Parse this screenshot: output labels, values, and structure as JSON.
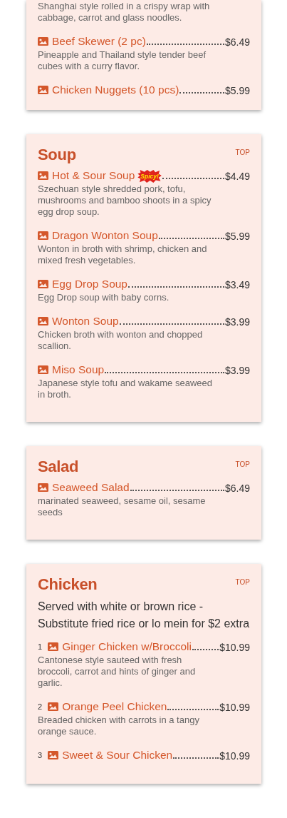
{
  "sections": [
    {
      "items": [
        {
          "description": "Shanghai style rolled in a crispy wrap with cabbage, carrot and glass noodles."
        },
        {
          "name": "Beef Skewer (2 pc)",
          "price": "$6.49",
          "description": "Pineapple and Thailand style tender beef cubes with a curry flavor."
        },
        {
          "name": "Chicken Nuggets (10 pcs)",
          "price": "$5.99"
        }
      ]
    },
    {
      "title": "Soup",
      "top_link": "TOP",
      "items": [
        {
          "name": "Hot & Sour Soup",
          "badge": "Spicy!",
          "price": "$4.49",
          "description": "Szechuan style shredded pork, tofu, mushrooms and bamboo shoots in a spicy egg drop soup."
        },
        {
          "name": "Dragon Wonton Soup",
          "price": "$5.99",
          "description": "Wonton in broth with shrimp, chicken and mixed fresh vegetables."
        },
        {
          "name": "Egg Drop Soup",
          "price": "$3.49",
          "description": "Egg Drop soup with baby corns."
        },
        {
          "name": "Wonton Soup",
          "price": "$3.99",
          "description": "Chicken broth with wonton and chopped scallion."
        },
        {
          "name": "Miso Soup",
          "price": "$3.99",
          "description": "Japanese style tofu and wakame seaweed in broth."
        }
      ]
    },
    {
      "title": "Salad",
      "top_link": "TOP",
      "items": [
        {
          "name": "Seaweed Salad",
          "price": "$6.49",
          "description": "marinated seaweed, sesame oil, sesame seeds"
        }
      ]
    },
    {
      "title": "Chicken",
      "top_link": "TOP",
      "note": "Served with white or brown rice - Substitute fried rice or lo mein for $2 extra",
      "items": [
        {
          "number": "1",
          "name": "Ginger Chicken w/Broccoli",
          "price": "$10.99",
          "description": "Cantonese style sauteed with fresh broccoli, carrot and hints of ginger and garlic."
        },
        {
          "number": "2",
          "name": "Orange Peel Chicken",
          "price": "$10.99",
          "description": "Breaded chicken with carrots in a tangy orange sauce."
        },
        {
          "number": "3",
          "name": "Sweet & Sour Chicken",
          "price": "$10.99"
        }
      ]
    }
  ]
}
